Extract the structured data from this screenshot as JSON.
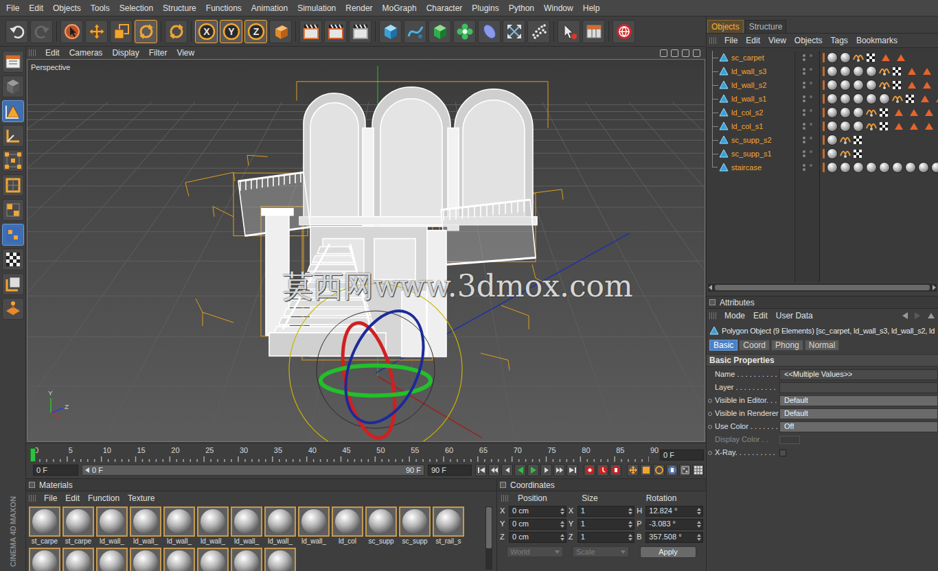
{
  "menu": [
    "File",
    "Edit",
    "Objects",
    "Tools",
    "Selection",
    "Structure",
    "Functions",
    "Animation",
    "Simulation",
    "Render",
    "MoGraph",
    "Character",
    "Plugins",
    "Python",
    "Window",
    "Help"
  ],
  "toolbar_tools": [
    {
      "selected": false
    },
    {
      "selected": false
    },
    {
      "selected": false
    },
    {
      "selected": false
    },
    {
      "selected": false
    },
    {
      "selected": true
    },
    {
      "selected": false
    },
    {
      "label": "X",
      "selected": true
    },
    {
      "label": "Y",
      "selected": true
    },
    {
      "label": "Z",
      "selected": true
    },
    {
      "selected": false
    },
    {
      "selected": false
    },
    {
      "selected": false
    },
    {
      "selected": false
    },
    {
      "selected": false
    },
    {
      "selected": false
    },
    {
      "selected": false
    },
    {
      "selected": false
    },
    {
      "selected": false
    },
    {
      "selected": false
    },
    {
      "selected": false
    },
    {
      "selected": false
    },
    {
      "selected": false
    },
    {
      "selected": false
    }
  ],
  "mode_tools": [
    {
      "selected": false
    },
    {
      "selected": false
    },
    {
      "selected": true
    },
    {
      "selected": false
    },
    {
      "selected": false
    },
    {
      "selected": false
    },
    {
      "selected": false
    },
    {
      "selected": true
    },
    {
      "selected": false
    },
    {
      "selected": false
    },
    {
      "selected": false
    }
  ],
  "viewport": {
    "menu": [
      "Edit",
      "Cameras",
      "Display",
      "Filter",
      "View"
    ],
    "camera": "Perspective",
    "watermark": "莫西网www.3dmox.com",
    "axis_labels": [
      "Y",
      "Z"
    ]
  },
  "timeline": {
    "ticks": [
      "0",
      "5",
      "10",
      "15",
      "20",
      "25",
      "30",
      "35",
      "40",
      "45",
      "50",
      "55",
      "60",
      "65",
      "70",
      "75",
      "80",
      "85",
      "90"
    ],
    "level": 0,
    "current": "0 F",
    "start": "0 F",
    "range_start": "0 F",
    "range_end": "90 F",
    "end": "90 F"
  },
  "materials": {
    "title": "Materials",
    "menu": [
      "File",
      "Edit",
      "Function",
      "Texture"
    ],
    "items": [
      {
        "label": "st_carpe"
      },
      {
        "label": "st_carpe"
      },
      {
        "label": "ld_wall_"
      },
      {
        "label": "ld_wall_"
      },
      {
        "label": "ld_wall_"
      },
      {
        "label": "ld_wall_"
      },
      {
        "label": "ld_wall_"
      },
      {
        "label": "ld_wall_"
      },
      {
        "label": "ld_wall_"
      },
      {
        "label": "ld_col"
      },
      {
        "label": "sc_supp"
      },
      {
        "label": "sc_supp"
      },
      {
        "label": "st_rail_s"
      }
    ],
    "partial_row": 8
  },
  "coordinates": {
    "title": "Coordinates",
    "columns": [
      "Position",
      "Size",
      "Rotation"
    ],
    "rows": [
      {
        "axis": "X",
        "position": "0 cm",
        "size_axis": "X",
        "size": "1",
        "rot_axis": "H",
        "rotation": "12.824 °"
      },
      {
        "axis": "Y",
        "position": "0 cm",
        "size_axis": "Y",
        "size": "1",
        "rot_axis": "P",
        "rotation": "-3.083 °"
      },
      {
        "axis": "Z",
        "position": "0 cm",
        "size_axis": "Z",
        "size": "1",
        "rot_axis": "B",
        "rotation": "357.508 °"
      }
    ],
    "dropdowns": [
      {
        "label": "World",
        "disabled": true
      },
      {
        "label": "Scale",
        "disabled": true
      }
    ],
    "apply": "Apply"
  },
  "objects_panel": {
    "tabs": [
      {
        "label": "Objects",
        "selected": true
      },
      {
        "label": "Structure",
        "selected": false
      }
    ],
    "menu": [
      "File",
      "Edit",
      "View",
      "Objects",
      "Tags",
      "Bookmarks"
    ],
    "objects": [
      {
        "name": "sc_carpet",
        "selected": true,
        "materials": 2,
        "phong": true,
        "texture": true,
        "warnings": 2
      },
      {
        "name": "ld_wall_s3",
        "selected": true,
        "materials": 4,
        "phong": true,
        "texture": true,
        "warnings": 4
      },
      {
        "name": "ld_wall_s2",
        "selected": true,
        "materials": 4,
        "phong": true,
        "texture": true,
        "warnings": 4
      },
      {
        "name": "ld_wall_s1",
        "selected": true,
        "materials": 5,
        "phong": true,
        "texture": true,
        "warnings": 3
      },
      {
        "name": "ld_col_s2",
        "selected": true,
        "materials": 3,
        "phong": true,
        "texture": true,
        "warnings": 3
      },
      {
        "name": "ld_col_s1",
        "selected": true,
        "materials": 3,
        "phong": true,
        "texture": true,
        "warnings": 3
      },
      {
        "name": "sc_supp_s2",
        "selected": true,
        "materials": 1,
        "phong": true,
        "texture": true,
        "warnings": 0
      },
      {
        "name": "sc_supp_s1",
        "selected": true,
        "materials": 1,
        "phong": true,
        "texture": true,
        "warnings": 0
      },
      {
        "name": "staircase",
        "selected": true,
        "materials": 10,
        "phong": false,
        "texture": false,
        "warnings": 0
      }
    ]
  },
  "attributes": {
    "title": "Attributes",
    "menu": [
      "Mode",
      "Edit",
      "User Data"
    ],
    "object_info": "Polygon Object (9 Elements) [sc_carpet, ld_wall_s3, ld_wall_s2, ld",
    "tabs": [
      {
        "label": "Basic",
        "selected": true
      },
      {
        "label": "Coord",
        "selected": false
      },
      {
        "label": "Phong",
        "selected": false
      },
      {
        "label": "Normal",
        "selected": false
      }
    ],
    "section": "Basic Properties",
    "fields": [
      {
        "label": "Name . . . . . . . . . .",
        "value": "<<Multiple Values>>",
        "kind": "text",
        "animatable": false,
        "disabled": false
      },
      {
        "label": "Layer . . . . . . . . . .",
        "value": "",
        "kind": "text",
        "animatable": false,
        "disabled": false
      },
      {
        "label": "Visible in Editor. . .",
        "value": "Default",
        "kind": "dropdown",
        "animatable": true,
        "disabled": false
      },
      {
        "label": "Visible in Renderer",
        "value": "Default",
        "kind": "dropdown",
        "animatable": true,
        "disabled": false
      },
      {
        "label": "Use Color . . . . . . .",
        "value": "Off",
        "kind": "dropdown",
        "animatable": true,
        "disabled": false
      },
      {
        "label": "Display Color . .",
        "value": "",
        "kind": "color",
        "animatable": false,
        "disabled": true
      },
      {
        "label": "X-Ray. . . . . . . . . .",
        "value": "",
        "kind": "checkbox",
        "checked": false,
        "animatable": true,
        "disabled": false
      }
    ]
  },
  "brand": [
    "MAXON",
    "CINEMA 4D"
  ]
}
